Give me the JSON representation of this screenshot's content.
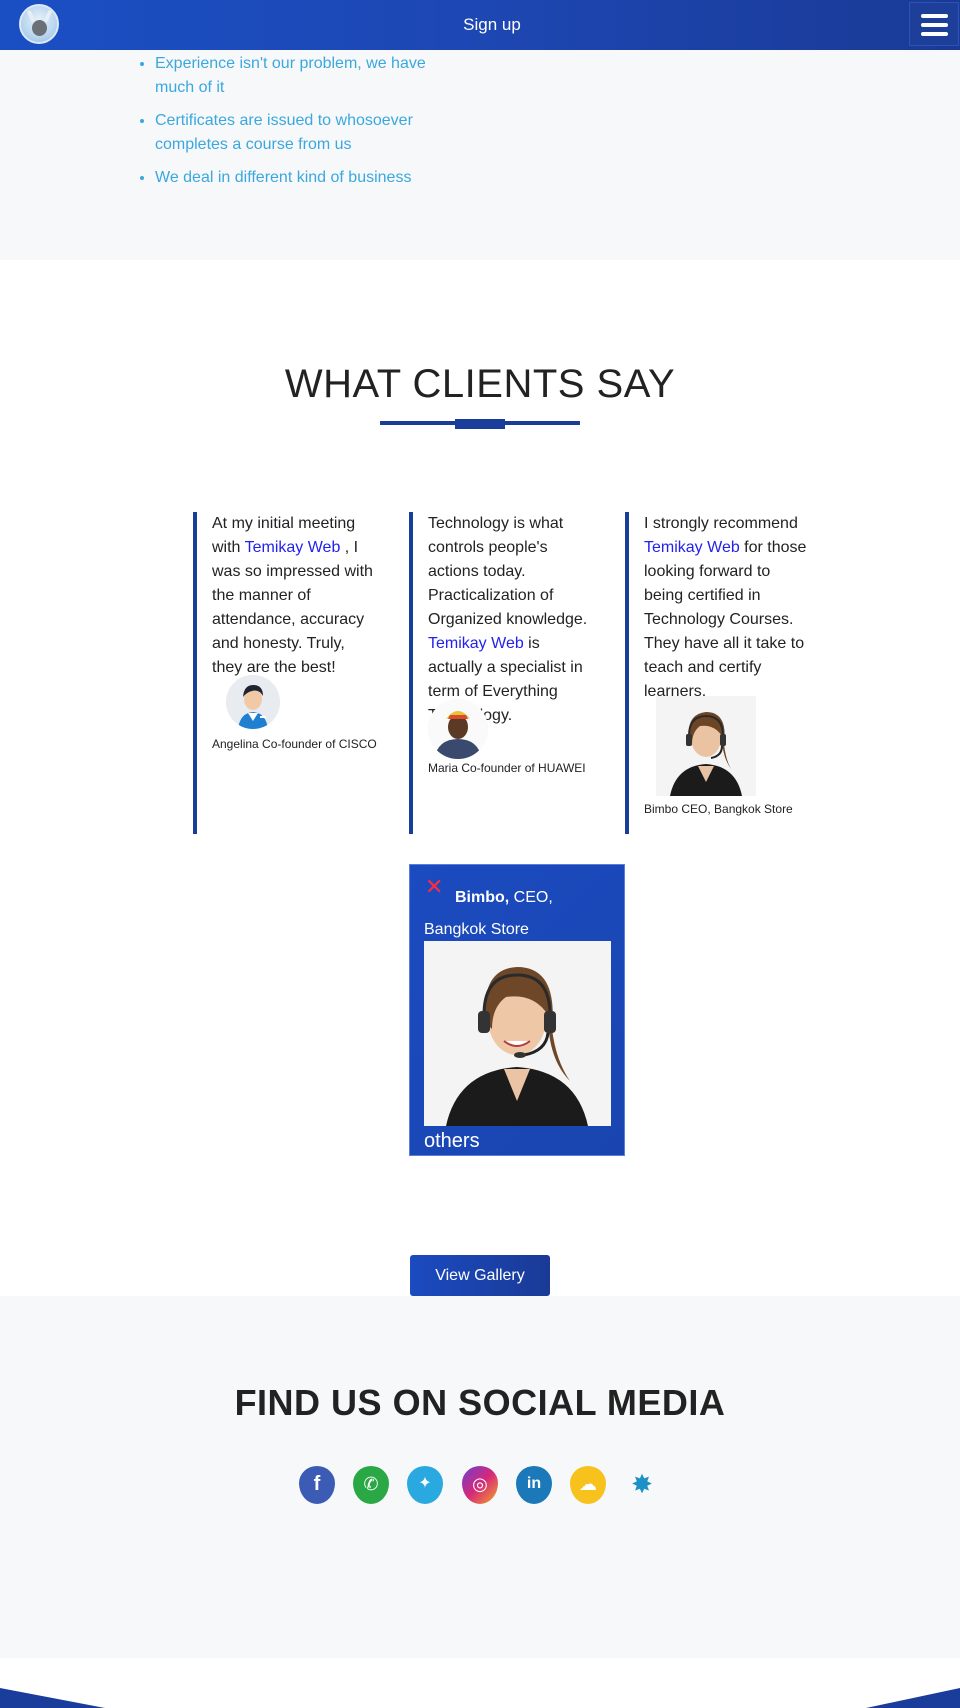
{
  "header": {
    "signup_label": "Sign up",
    "logo_icon": "bull-logo-icon",
    "menu_icon": "hamburger-icon"
  },
  "features": {
    "items": [
      "Experience isn't our problem, we have much of it",
      "Certificates are issued to whosoever completes a course from us",
      "We deal in different kind of business"
    ]
  },
  "clients": {
    "title": "WHAT CLIENTS SAY",
    "testimonials": [
      {
        "quote_before": "At my initial meeting with ",
        "brand": "Temikay Web",
        "quote_after": " , I was so impressed with the manner of attendance, accuracy and honesty. Truly, they are the best!",
        "author": "Angelina Co-founder of CISCO"
      },
      {
        "quote_before": "Technology is what controls people's actions today. Practicalization of Organized knowledge. ",
        "brand": "Temikay Web",
        "quote_after": " is actually a specialist in term of Everything Technology.",
        "author": "Maria Co-founder of HUAWEI"
      },
      {
        "quote_before": "I strongly recommend ",
        "brand": "Temikay Web",
        "quote_after": " for those looking forward to being certified in Technology Courses. They have all it take to teach and certify learners.",
        "author": "Bimbo CEO, Bangkok Store"
      }
    ]
  },
  "popup": {
    "close_icon": "close-icon",
    "name": "Bimbo,",
    "role": " CEO,",
    "company": "Bangkok Store",
    "others_label": "others"
  },
  "gallery": {
    "button_label": "View Gallery"
  },
  "social": {
    "title": "FIND US ON SOCIAL MEDIA",
    "icons": [
      {
        "name": "facebook-icon",
        "glyph": "f",
        "color": "#3b5bb5"
      },
      {
        "name": "whatsapp-icon",
        "glyph": "✆",
        "color": "#2aa845"
      },
      {
        "name": "twitter-icon",
        "glyph": "🐦",
        "color": "#2aa9e0"
      },
      {
        "name": "instagram-icon",
        "glyph": "◎",
        "color": "#c13584"
      },
      {
        "name": "linkedin-icon",
        "glyph": "in",
        "color": "#1b78b9"
      },
      {
        "name": "snapchat-icon",
        "glyph": "👻",
        "color": "#f7c21b"
      },
      {
        "name": "telegram-icon",
        "glyph": "➤",
        "color": "#1e90c8"
      }
    ]
  }
}
